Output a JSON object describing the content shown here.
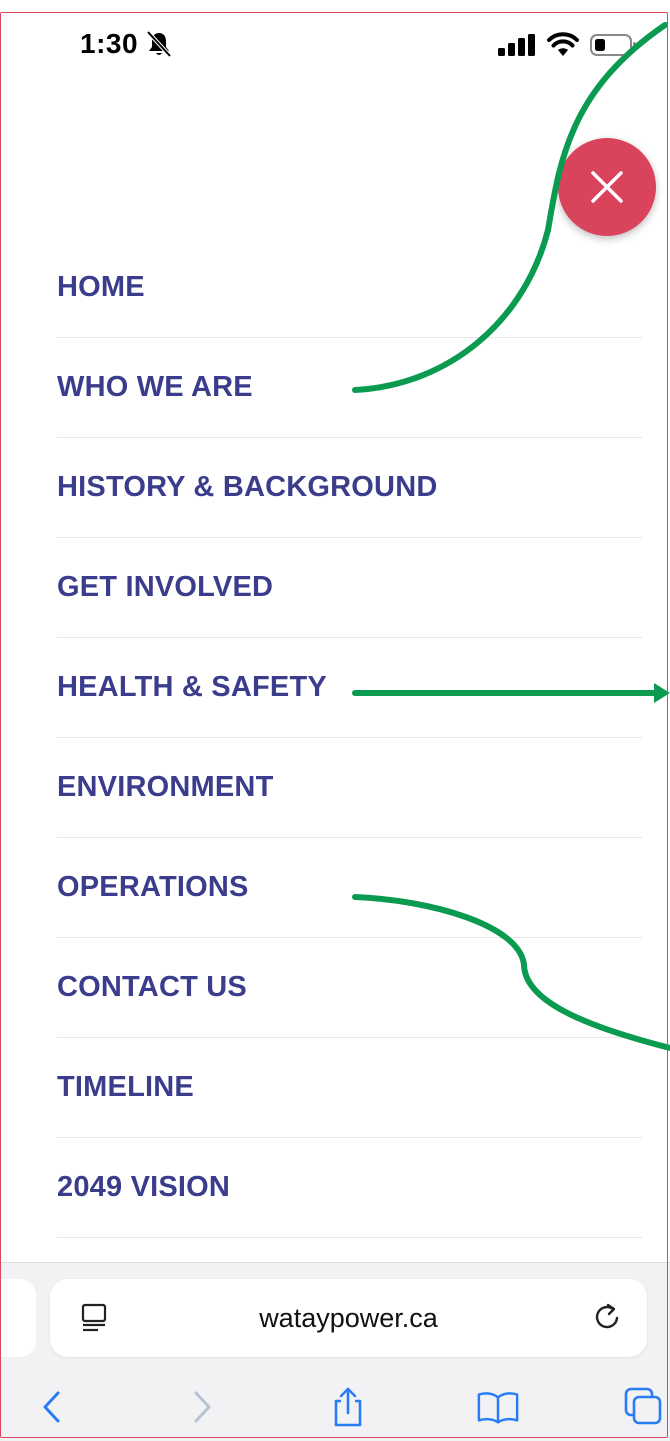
{
  "status_bar": {
    "time": "1:30",
    "icons": [
      "bell-slash-icon",
      "signal-icon",
      "wifi-icon",
      "battery-icon"
    ]
  },
  "close_button": {
    "icon": "close-icon",
    "color": "#d9435b"
  },
  "menu": {
    "color": "#3b3c8c",
    "items": [
      {
        "label": "HOME"
      },
      {
        "label": "WHO WE ARE"
      },
      {
        "label": "HISTORY & BACKGROUND"
      },
      {
        "label": "GET INVOLVED"
      },
      {
        "label": "HEALTH & SAFETY"
      },
      {
        "label": "ENVIRONMENT"
      },
      {
        "label": "OPERATIONS"
      },
      {
        "label": "CONTACT US"
      },
      {
        "label": "TIMELINE"
      },
      {
        "label": "2049 VISION"
      }
    ]
  },
  "annotations": {
    "color": "#0a9a50"
  },
  "browser": {
    "url": "wataypower.ca",
    "icons": [
      "reader-icon",
      "reload-icon",
      "back-icon",
      "forward-icon",
      "share-icon",
      "bookmarks-icon",
      "tabs-icon"
    ]
  }
}
